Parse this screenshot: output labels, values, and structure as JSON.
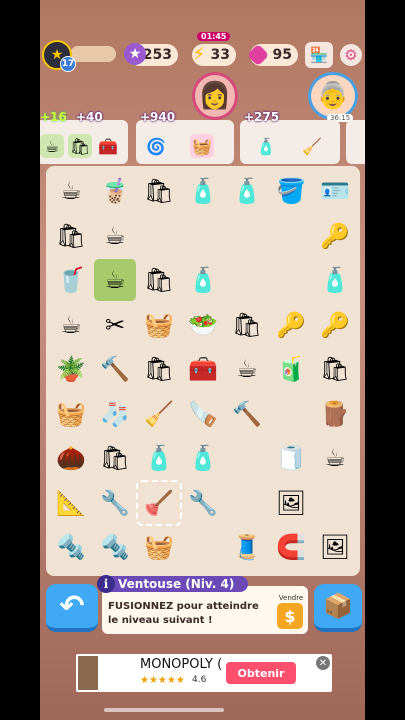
{
  "topbar": {
    "level": "17",
    "xp_value": "253",
    "energy_value": "33",
    "energy_timer": "01:45",
    "gems_value": "95"
  },
  "characters": {
    "right_timer": "36:15"
  },
  "orders": [
    {
      "reward": "+16",
      "reward2": "+40"
    },
    {
      "reward": "+940"
    },
    {
      "reward": "+275"
    }
  ],
  "board": {
    "columns": 7,
    "rows": 9,
    "cells": [
      [
        "☕",
        "🧋",
        "🛍",
        "🧴",
        "🧴",
        "🪣",
        "🪪"
      ],
      [
        "🛍",
        "☕",
        "",
        "",
        "",
        "",
        "🔑"
      ],
      [
        "🥤",
        "☕",
        "🛍",
        "🧴",
        "",
        "",
        "🧴"
      ],
      [
        "☕",
        "✂",
        "🧺",
        "🥗",
        "🛍",
        "🔑",
        "🔑"
      ],
      [
        "🪴",
        "🔨",
        "🛍",
        "🧰",
        "☕",
        "🧃",
        "🛍"
      ],
      [
        "🧺",
        "🧦",
        "🧹",
        "🪚",
        "🔨",
        "",
        "🪵"
      ],
      [
        "🌰",
        "🛍",
        "🧴",
        "🧴",
        "",
        "🧻",
        "☕"
      ],
      [
        "📐",
        "🔧",
        "🪠",
        "🔧",
        "",
        "🖼",
        ""
      ],
      [
        "🔩",
        "🔩",
        "🧺",
        "",
        "🧵",
        "🧲",
        "🖼"
      ]
    ]
  },
  "info": {
    "title": "Ventouse (Niv. 4)",
    "text": "FUSIONNEZ pour atteindre le niveau suivant !",
    "sell_label": "Vendre",
    "sell_icon": "$"
  },
  "ad": {
    "title": "MONOPOLY (",
    "rating": "4.6",
    "cta": "Obtenir"
  }
}
